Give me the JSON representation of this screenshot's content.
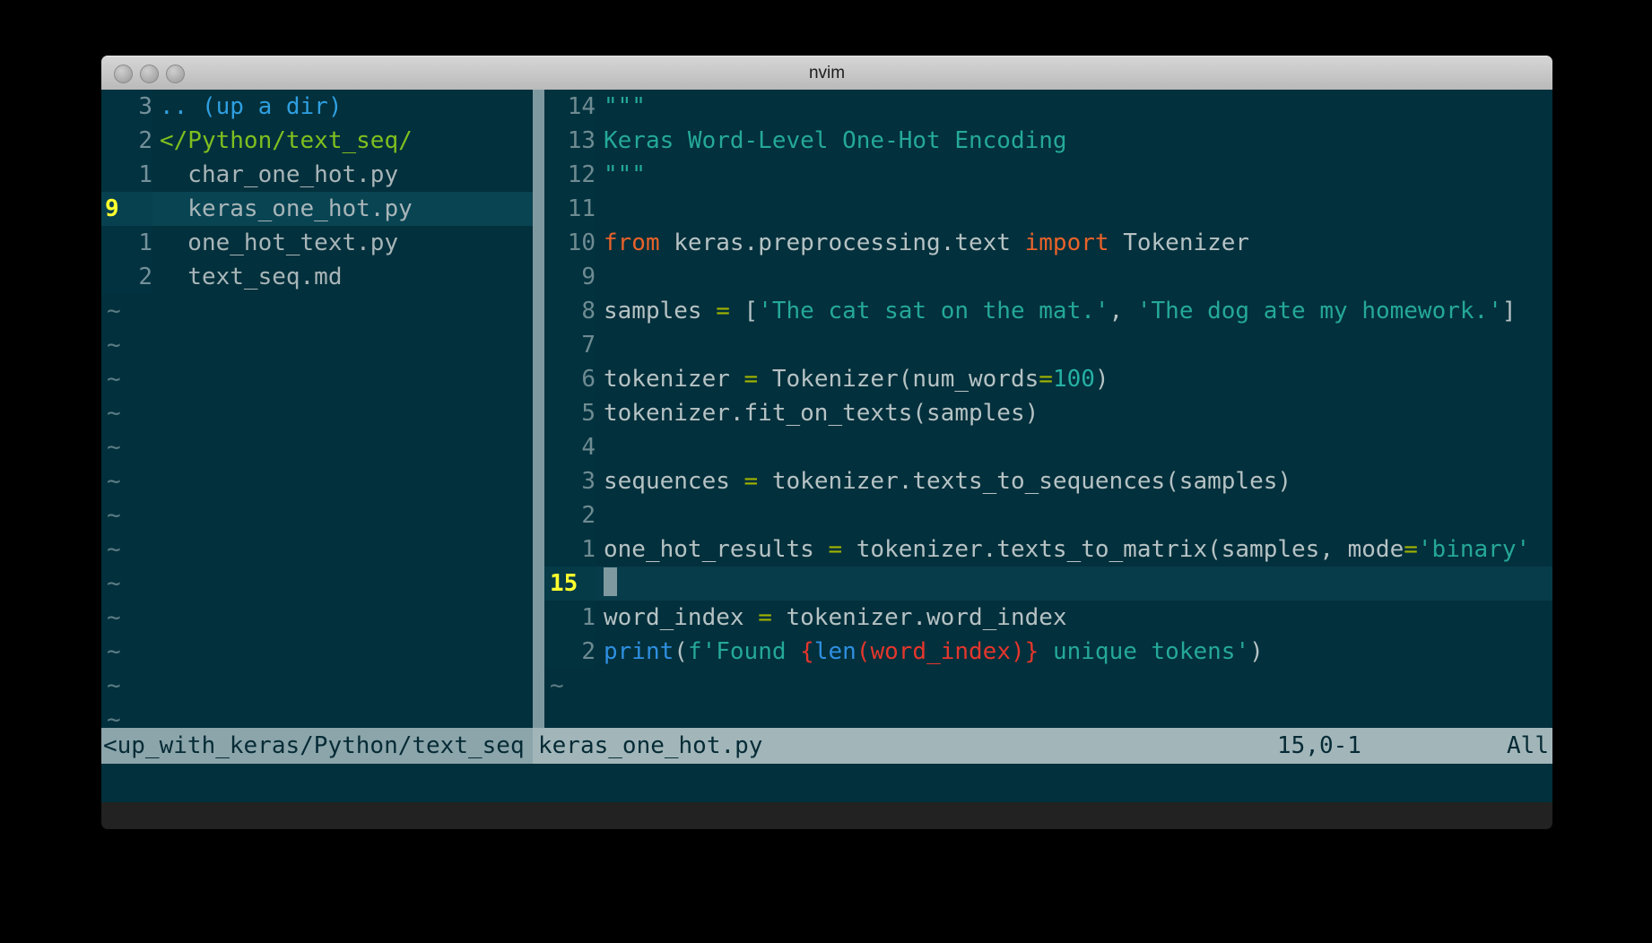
{
  "window": {
    "title": "nvim",
    "traffic_lights": [
      "close-button",
      "minimize-button",
      "maximize-button"
    ]
  },
  "explorer": {
    "name": "netrw-file-explorer",
    "rows": [
      {
        "num": "3",
        "text": ".. (up a dir)",
        "kind": "dir",
        "selected": false
      },
      {
        "num": "2",
        "text": "</Python/text_seq/",
        "kind": "tree",
        "selected": false
      },
      {
        "num": "1",
        "text": "  char_one_hot.py",
        "kind": "file",
        "selected": false
      },
      {
        "num": "9",
        "text": "  keras_one_hot.py",
        "kind": "file",
        "selected": true
      },
      {
        "num": "1",
        "text": "  one_hot_text.py",
        "kind": "file",
        "selected": false
      },
      {
        "num": "2",
        "text": "  text_seq.md",
        "kind": "file",
        "selected": false
      }
    ],
    "filler": [
      "~",
      "~",
      "~",
      "~",
      "~",
      "~",
      "~",
      "~",
      "~",
      "~",
      "~",
      "~",
      "~",
      "~"
    ]
  },
  "editor": {
    "name": "python-buffer",
    "filename": "keras_one_hot.py",
    "lines": [
      {
        "num": "14",
        "cursor": false,
        "tokens": [
          {
            "t": "\"\"\"",
            "c": "comment"
          }
        ]
      },
      {
        "num": "13",
        "cursor": false,
        "tokens": [
          {
            "t": "Keras Word-Level One-Hot Encoding",
            "c": "comment"
          }
        ]
      },
      {
        "num": "12",
        "cursor": false,
        "tokens": [
          {
            "t": "\"\"\"",
            "c": "comment"
          }
        ]
      },
      {
        "num": "11",
        "cursor": false,
        "tokens": []
      },
      {
        "num": "10",
        "cursor": false,
        "tokens": [
          {
            "t": "from",
            "c": "keyword"
          },
          {
            "t": " keras.preprocessing.text ",
            "c": "plain"
          },
          {
            "t": "import",
            "c": "keyword"
          },
          {
            "t": " Tokenizer",
            "c": "plain"
          }
        ]
      },
      {
        "num": "9",
        "cursor": false,
        "tokens": []
      },
      {
        "num": "8",
        "cursor": false,
        "tokens": [
          {
            "t": "samples ",
            "c": "plain"
          },
          {
            "t": "=",
            "c": "op"
          },
          {
            "t": " [",
            "c": "plain"
          },
          {
            "t": "'The cat sat on the mat.'",
            "c": "string"
          },
          {
            "t": ", ",
            "c": "plain"
          },
          {
            "t": "'The dog ate my homework.'",
            "c": "string"
          },
          {
            "t": "]",
            "c": "plain"
          }
        ]
      },
      {
        "num": "7",
        "cursor": false,
        "tokens": []
      },
      {
        "num": "6",
        "cursor": false,
        "tokens": [
          {
            "t": "tokenizer ",
            "c": "plain"
          },
          {
            "t": "=",
            "c": "op"
          },
          {
            "t": " Tokenizer(num_words",
            "c": "plain"
          },
          {
            "t": "=",
            "c": "op"
          },
          {
            "t": "100",
            "c": "num"
          },
          {
            "t": ")",
            "c": "plain"
          }
        ]
      },
      {
        "num": "5",
        "cursor": false,
        "tokens": [
          {
            "t": "tokenizer.fit_on_texts(samples)",
            "c": "plain"
          }
        ]
      },
      {
        "num": "4",
        "cursor": false,
        "tokens": []
      },
      {
        "num": "3",
        "cursor": false,
        "tokens": [
          {
            "t": "sequences ",
            "c": "plain"
          },
          {
            "t": "=",
            "c": "op"
          },
          {
            "t": " tokenizer.texts_to_sequences(samples)",
            "c": "plain"
          }
        ]
      },
      {
        "num": "2",
        "cursor": false,
        "tokens": []
      },
      {
        "num": "1",
        "cursor": false,
        "tokens": [
          {
            "t": "one_hot_results ",
            "c": "plain"
          },
          {
            "t": "=",
            "c": "op"
          },
          {
            "t": " tokenizer.texts_to_matrix(samples, mode",
            "c": "plain"
          },
          {
            "t": "=",
            "c": "op"
          },
          {
            "t": "'binary'",
            "c": "string"
          }
        ]
      },
      {
        "num": "15",
        "cursor": true,
        "tokens": []
      },
      {
        "num": "1",
        "cursor": false,
        "tokens": [
          {
            "t": "word_index ",
            "c": "plain"
          },
          {
            "t": "=",
            "c": "op"
          },
          {
            "t": " tokenizer.word_index",
            "c": "plain"
          }
        ]
      },
      {
        "num": "2",
        "cursor": false,
        "tokens": [
          {
            "t": "print",
            "c": "func"
          },
          {
            "t": "(",
            "c": "plain"
          },
          {
            "t": "f'Found ",
            "c": "string"
          },
          {
            "t": "{",
            "c": "special"
          },
          {
            "t": "len",
            "c": "func"
          },
          {
            "t": "(word_index)",
            "c": "special"
          },
          {
            "t": "}",
            "c": "special"
          },
          {
            "t": " unique tokens'",
            "c": "string"
          },
          {
            "t": ")",
            "c": "plain"
          }
        ]
      }
    ],
    "filler": [
      "~"
    ]
  },
  "statusline": {
    "left_path": "<up_with_keras/Python/text_seq",
    "right_file": "keras_one_hot.py",
    "position": "15,0-1",
    "scroll": "All"
  },
  "colors": {
    "background": "#02303c",
    "cursorline": "#073c4a",
    "status_bg": "#a2b6ba",
    "linenr": "#6f8b92",
    "cursor_linenr": "#ffff2e",
    "string": "#25a899",
    "keyword": "#e8622a",
    "operator": "#a1b300",
    "number": "#25b0a4",
    "function": "#2f8fe0",
    "special": "#e5362c",
    "plain": "#b6c2c4",
    "dir": "#2f9fe0",
    "tree": "#7fbf1f"
  }
}
